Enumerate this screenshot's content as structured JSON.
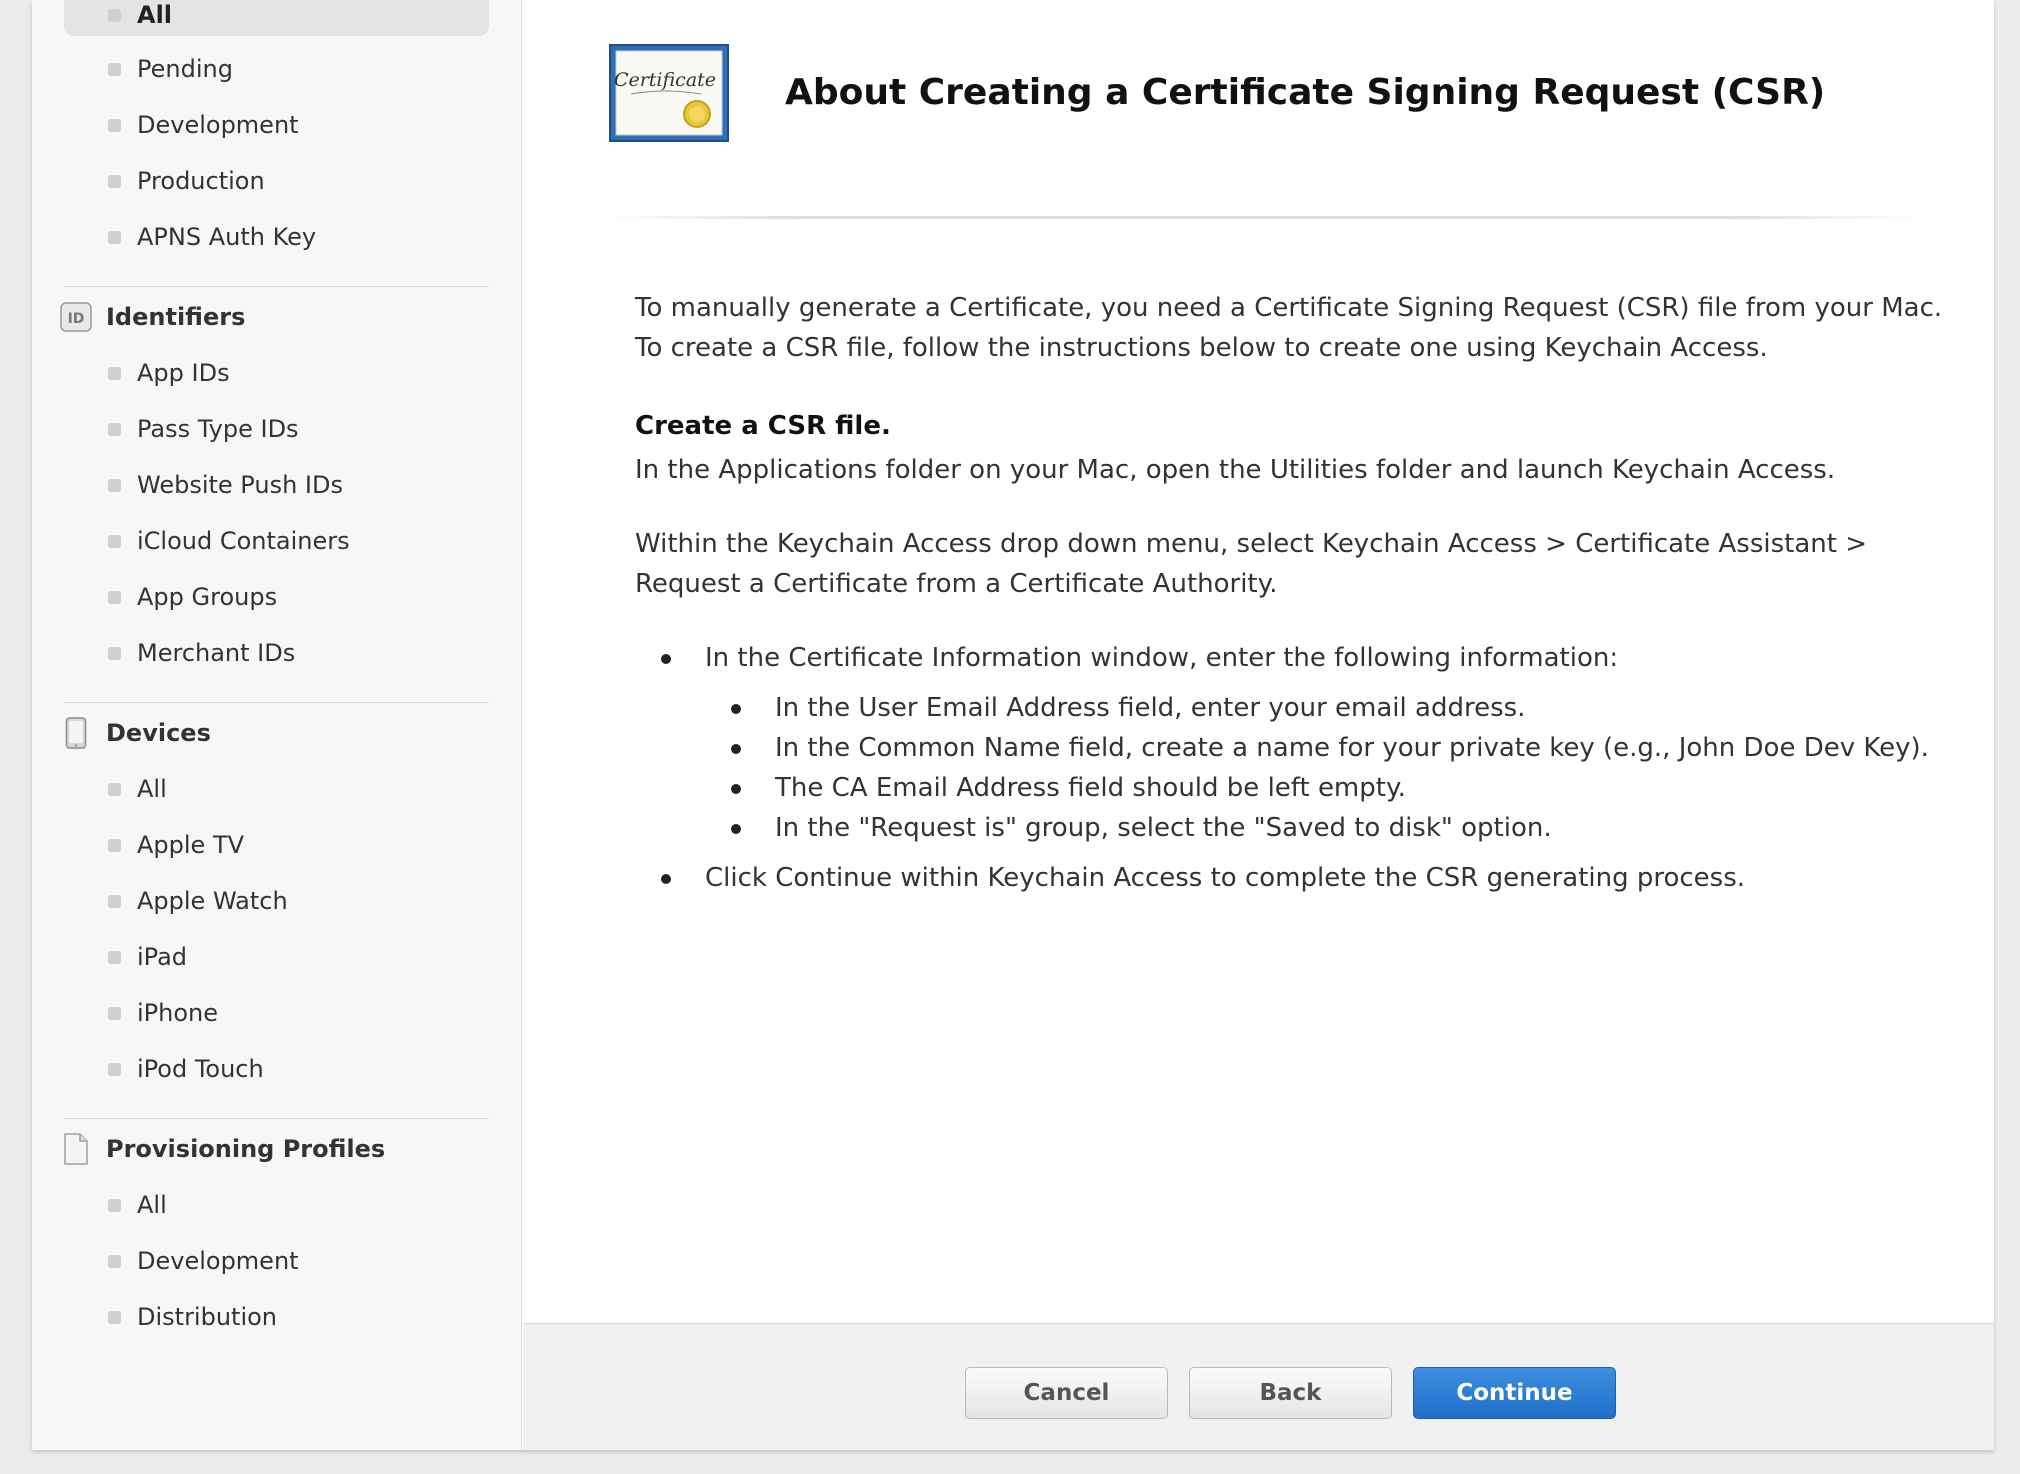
{
  "sidebar": {
    "certificates_items": [
      {
        "label": "All",
        "active": true
      },
      {
        "label": "Pending"
      },
      {
        "label": "Development"
      },
      {
        "label": "Production"
      },
      {
        "label": "APNS Auth Key"
      }
    ],
    "identifiers": {
      "title": "Identifiers",
      "icon": "id-badge-icon",
      "icon_text": "ID",
      "items": [
        "App IDs",
        "Pass Type IDs",
        "Website Push IDs",
        "iCloud Containers",
        "App Groups",
        "Merchant IDs"
      ]
    },
    "devices": {
      "title": "Devices",
      "icon": "device-icon",
      "items": [
        "All",
        "Apple TV",
        "Apple Watch",
        "iPad",
        "iPhone",
        "iPod Touch"
      ]
    },
    "provisioning": {
      "title": "Provisioning Profiles",
      "icon": "document-icon",
      "items": [
        "All",
        "Development",
        "Distribution"
      ]
    }
  },
  "main": {
    "icon": "certificate-icon",
    "icon_text": "Certificate",
    "title": "About Creating a Certificate Signing Request (CSR)",
    "intro": "To manually generate a Certificate, you need a Certificate Signing Request (CSR) file from your Mac. To create a CSR file, follow the instructions below to create one using Keychain Access.",
    "subhead": "Create a CSR file.",
    "step1": "In the Applications folder on your Mac, open the Utilities folder and launch Keychain Access.",
    "step2": "Within the Keychain Access drop down menu, select Keychain Access > Certificate Assistant > Request a Certificate from a Certificate Authority.",
    "bullets": [
      {
        "text": "In the Certificate Information window, enter the following information:",
        "sub": [
          "In the User Email Address field, enter your email address.",
          "In the Common Name field, create a name for your private key (e.g., John Doe Dev Key).",
          "The CA Email Address field should be left empty.",
          "In the \"Request is\" group, select the \"Saved to disk\" option."
        ]
      },
      {
        "text": "Click Continue within Keychain Access to complete the CSR generating process."
      }
    ]
  },
  "footer": {
    "cancel": "Cancel",
    "back": "Back",
    "continue": "Continue"
  },
  "colors": {
    "primary_button": "#2a7fd5",
    "sidebar_bg": "#f7f7f7",
    "active_item_bg": "#e4e4e4"
  }
}
